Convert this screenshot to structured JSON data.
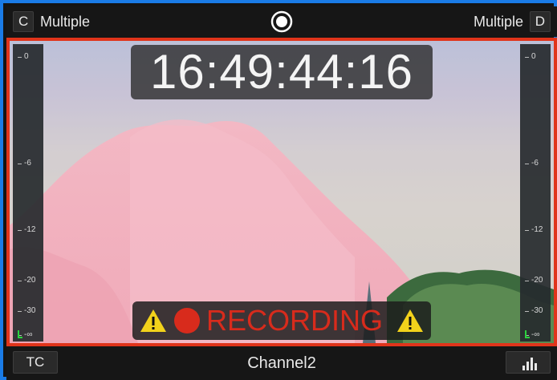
{
  "top": {
    "left_chip": "C",
    "left_label": "Multiple",
    "right_label": "Multiple",
    "right_chip": "D",
    "record_icon": "record-target-icon"
  },
  "viewer": {
    "timecode": "16:49:44:16",
    "recording_label": "RECORDING",
    "border_color": "#e0341b",
    "meter_ticks": [
      "0",
      "-6",
      "-12",
      "-20",
      "-30",
      "-∞"
    ]
  },
  "bottom": {
    "tc_button": "TC",
    "channel": "Channel2",
    "meters_icon": "bar-chart-icon"
  },
  "colors": {
    "accent": "#1a7be6",
    "recording": "#d82b1c",
    "warning": "#f2d21b",
    "meter_level": "#2bd13d"
  }
}
